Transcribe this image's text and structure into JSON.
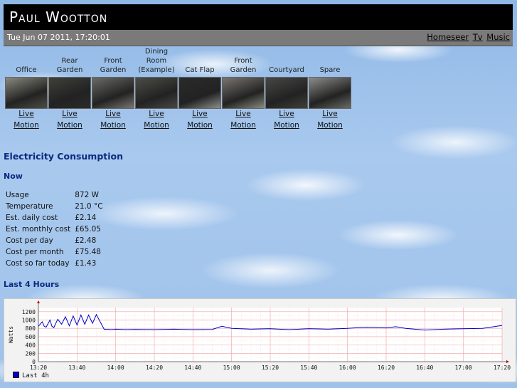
{
  "header": {
    "title": "Paul Wootton",
    "datetime": "Tue Jun 07 2011, 17:20:01",
    "links": [
      "Homeseer",
      "Tv",
      "Music"
    ]
  },
  "cameras": [
    {
      "name": "Office",
      "live": "Live",
      "motion": "Motion"
    },
    {
      "name": "Rear Garden",
      "live": "Live",
      "motion": "Motion"
    },
    {
      "name": "Front Garden",
      "live": "Live",
      "motion": "Motion"
    },
    {
      "name": "Dining Room (Example)",
      "live": "Live",
      "motion": "Motion"
    },
    {
      "name": "Cat Flap",
      "live": "Live",
      "motion": "Motion"
    },
    {
      "name": "Front Garden",
      "live": "Live",
      "motion": "Motion"
    },
    {
      "name": "Courtyard",
      "live": "Live",
      "motion": "Motion"
    },
    {
      "name": "Spare",
      "live": "Live",
      "motion": "Motion"
    }
  ],
  "electricity": {
    "heading": "Electricity Consumption",
    "now_heading": "Now",
    "stats": [
      {
        "label": "Usage",
        "value": "872 W"
      },
      {
        "label": "Temperature",
        "value": "21.0 °C"
      },
      {
        "label": "Est. daily cost",
        "value": "£2.14"
      },
      {
        "label": "Est. monthly cost",
        "value": "£65.05"
      },
      {
        "label": "Cost per day",
        "value": "£2.48"
      },
      {
        "label": "Cost per month",
        "value": "£75.48"
      },
      {
        "label": "Cost so far today",
        "value": "£1.43"
      }
    ],
    "graph_heading": "Last 4 Hours"
  },
  "chart_data": {
    "type": "line",
    "title": "",
    "xlabel": "",
    "ylabel": "Watts",
    "ylim": [
      0,
      1300
    ],
    "yticks": [
      0,
      200,
      400,
      600,
      800,
      1000,
      1200
    ],
    "xticks": [
      "13:20",
      "13:40",
      "14:00",
      "14:20",
      "14:40",
      "15:00",
      "15:20",
      "15:40",
      "16:00",
      "16:20",
      "16:40",
      "17:00",
      "17:20"
    ],
    "x_minutes_from_1320": [
      0,
      2,
      3,
      4,
      6,
      7,
      8,
      10,
      12,
      14,
      16,
      18,
      20,
      22,
      24,
      26,
      28,
      30,
      34,
      38,
      40,
      45,
      50,
      60,
      70,
      80,
      90,
      95,
      100,
      110,
      120,
      130,
      140,
      150,
      160,
      170,
      180,
      185,
      190,
      200,
      210,
      220,
      230,
      240
    ],
    "series": [
      {
        "name": "Last 4h",
        "values": [
          850,
          960,
          850,
          830,
          1000,
          850,
          820,
          1020,
          900,
          1080,
          860,
          1100,
          880,
          1120,
          900,
          1120,
          920,
          1130,
          780,
          770,
          780,
          770,
          775,
          770,
          780,
          770,
          775,
          850,
          800,
          780,
          790,
          770,
          790,
          780,
          800,
          830,
          810,
          840,
          800,
          760,
          780,
          790,
          800,
          870
        ]
      }
    ],
    "legend": "bottom-left",
    "grid": true
  }
}
